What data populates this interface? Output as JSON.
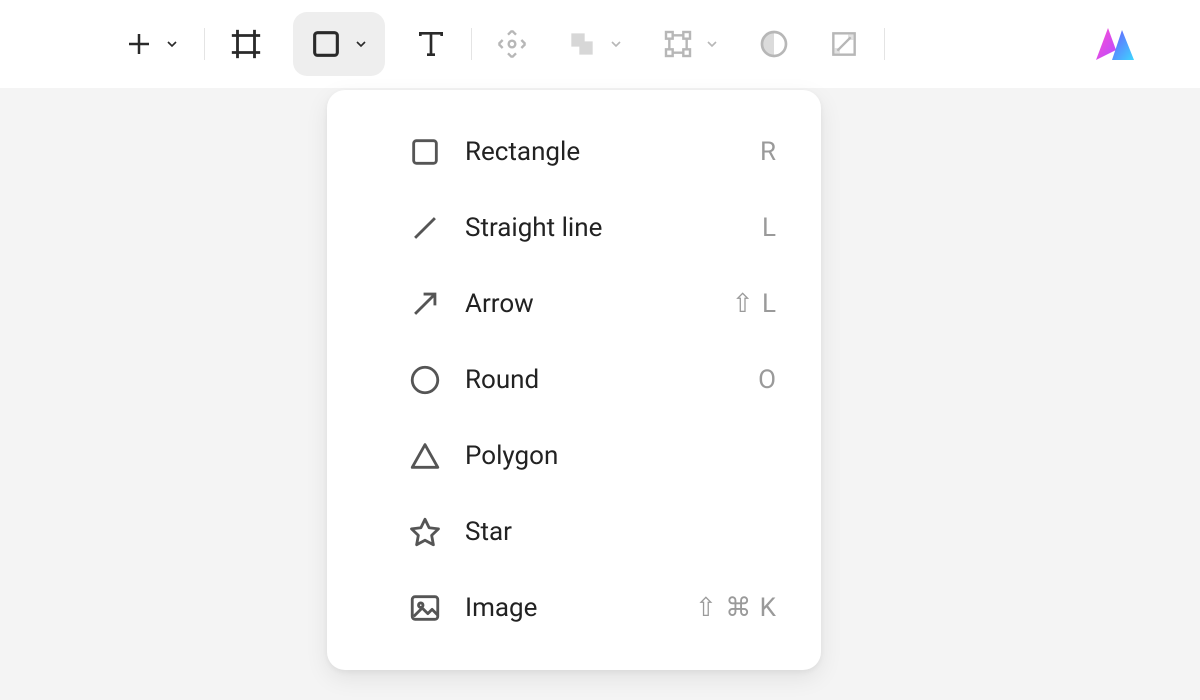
{
  "toolbar": {
    "tools": [
      {
        "name": "add",
        "has_dropdown": true,
        "disabled": false
      },
      {
        "name": "frame",
        "has_dropdown": false,
        "disabled": false
      },
      {
        "name": "shape",
        "has_dropdown": true,
        "disabled": false,
        "active": true
      },
      {
        "name": "text",
        "has_dropdown": false,
        "disabled": false
      },
      {
        "name": "move",
        "has_dropdown": false,
        "disabled": true
      },
      {
        "name": "boolean",
        "has_dropdown": true,
        "disabled": true
      },
      {
        "name": "path",
        "has_dropdown": true,
        "disabled": true
      },
      {
        "name": "mask",
        "has_dropdown": false,
        "disabled": true
      },
      {
        "name": "crop",
        "has_dropdown": false,
        "disabled": true
      }
    ]
  },
  "shape_menu": {
    "items": [
      {
        "id": "rectangle",
        "label": "Rectangle",
        "shortcut": "R"
      },
      {
        "id": "line",
        "label": "Straight line",
        "shortcut": "L"
      },
      {
        "id": "arrow",
        "label": "Arrow",
        "shortcut": "⇧ L"
      },
      {
        "id": "round",
        "label": "Round",
        "shortcut": "O"
      },
      {
        "id": "polygon",
        "label": "Polygon",
        "shortcut": ""
      },
      {
        "id": "star",
        "label": "Star",
        "shortcut": ""
      },
      {
        "id": "image",
        "label": "Image",
        "shortcut": "⇧ ⌘ K"
      }
    ]
  }
}
